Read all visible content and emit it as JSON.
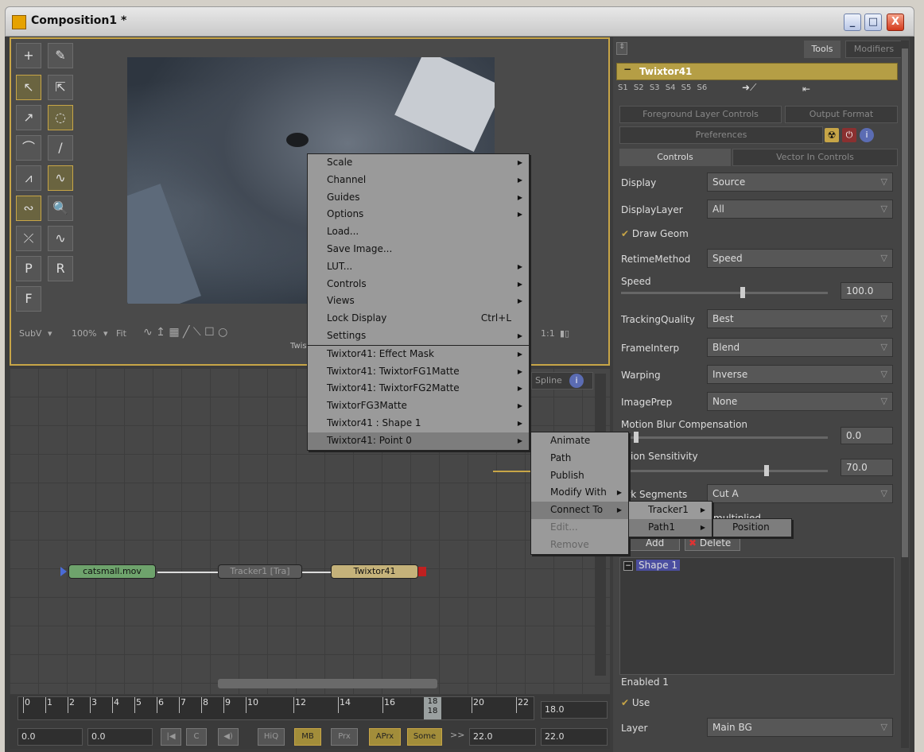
{
  "window": {
    "title": "Composition1 *",
    "min": "_",
    "max": "□",
    "close": "X"
  },
  "viewer": {
    "bar": {
      "subv": "SubV",
      "zoom": "100%",
      "fit": "Fit",
      "ratio": "1:1",
      "caption": "Twist"
    }
  },
  "flow": {
    "nodes": {
      "loader": "catsmall.mov",
      "tracker": "Tracker1 [Tra]",
      "twixtor": "Twixtor41"
    },
    "tabs": {
      "spline": "Spline"
    }
  },
  "timeline": {
    "labels": [
      "0",
      "1",
      "2",
      "3",
      "4",
      "5",
      "6",
      "7",
      "8",
      "9",
      "10",
      "12",
      "14",
      "16",
      "18",
      "20",
      "22"
    ],
    "current_frame_top": "18",
    "current_frame_bottom": "18",
    "current_time": "18.0",
    "start": "0.0",
    "render_start": "0.0",
    "render_end": "22.0",
    "end": "22.0",
    "buttons": {
      "hiq": "HiQ",
      "mb": "MB",
      "prx": "Prx",
      "aprx": "APrx",
      "some": "Some",
      "next": ">>"
    }
  },
  "panel": {
    "tabs": {
      "tools": "Tools",
      "modifiers": "Modifiers"
    },
    "tool_name": "Twixtor41",
    "slots": [
      "S1",
      "S2",
      "S3",
      "S4",
      "S5",
      "S6"
    ],
    "subtabs": {
      "foreground": "Foreground Layer Controls",
      "output": "Output Format",
      "preferences": "Preferences",
      "controls": "Controls",
      "vector": "Vector In Controls"
    },
    "display": {
      "label": "Display",
      "value": "Source"
    },
    "display_layer": {
      "label": "DisplayLayer",
      "value": "All"
    },
    "draw_geom": "Draw Geom",
    "retime": {
      "label": "RetimeMethod",
      "value": "Speed"
    },
    "speed": {
      "label": "Speed",
      "value": "100.0"
    },
    "tracking": {
      "label": "TrackingQuality",
      "value": "Best"
    },
    "frame_interp": {
      "label": "FrameInterp",
      "value": "Blend"
    },
    "warping": {
      "label": "Warping",
      "value": "Inverse"
    },
    "image_prep": {
      "label": "ImagePrep",
      "value": "None"
    },
    "mbc": {
      "label": "Motion Blur Compensation",
      "value": "0.0"
    },
    "motion_sens": {
      "label": "Motion Sensitivity",
      "label_visible": "otion Sensitivity",
      "value": "70.0"
    },
    "mark_segments": {
      "label": "ark Segments",
      "value": "Cut A"
    },
    "multiplied": "multiplied",
    "add": "Add",
    "delete": "Delete",
    "shape": "Shape 1",
    "enabled": "Enabled 1",
    "use": "Use",
    "layer": {
      "label": "Layer",
      "value": "Main BG"
    }
  },
  "menu": {
    "items": [
      {
        "label": "Scale",
        "sub": true
      },
      {
        "label": "Channel",
        "sub": true
      },
      {
        "label": "Guides",
        "sub": true
      },
      {
        "label": "Options",
        "sub": true
      },
      {
        "label": "Load...",
        "sub": false
      },
      {
        "label": "Save Image...",
        "sub": false
      },
      {
        "label": "LUT...",
        "sub": true
      },
      {
        "label": "Controls",
        "sub": true
      },
      {
        "label": "Views",
        "sub": true
      },
      {
        "label": "Lock Display",
        "shortcut": "Ctrl+L",
        "sub": false
      },
      {
        "label": "Settings",
        "sub": true
      }
    ],
    "items2": [
      {
        "label": "Twixtor41: Effect Mask",
        "sub": true
      },
      {
        "label": "Twixtor41: TwixtorFG1Matte",
        "sub": true
      },
      {
        "label": "Twixtor41: TwixtorFG2Matte",
        "sub": true
      },
      {
        "label": "TwixtorFG3Matte",
        "sub": true
      },
      {
        "label": "Twixtor41 : Shape 1",
        "sub": true
      },
      {
        "label": "Twixtor41: Point 0",
        "sub": true
      }
    ]
  },
  "submenu": {
    "items": [
      {
        "label": "Animate"
      },
      {
        "label": "Path"
      },
      {
        "label": "Publish"
      },
      {
        "label": "Modify With",
        "sub": true
      },
      {
        "label": "Connect To",
        "sub": true
      },
      {
        "label": "Edit...",
        "disabled": true
      },
      {
        "label": "Remove",
        "disabled": true
      }
    ]
  },
  "submenu2": {
    "tracker": "Tracker1",
    "path": "Path1"
  },
  "submenu3": {
    "position": "Position"
  }
}
